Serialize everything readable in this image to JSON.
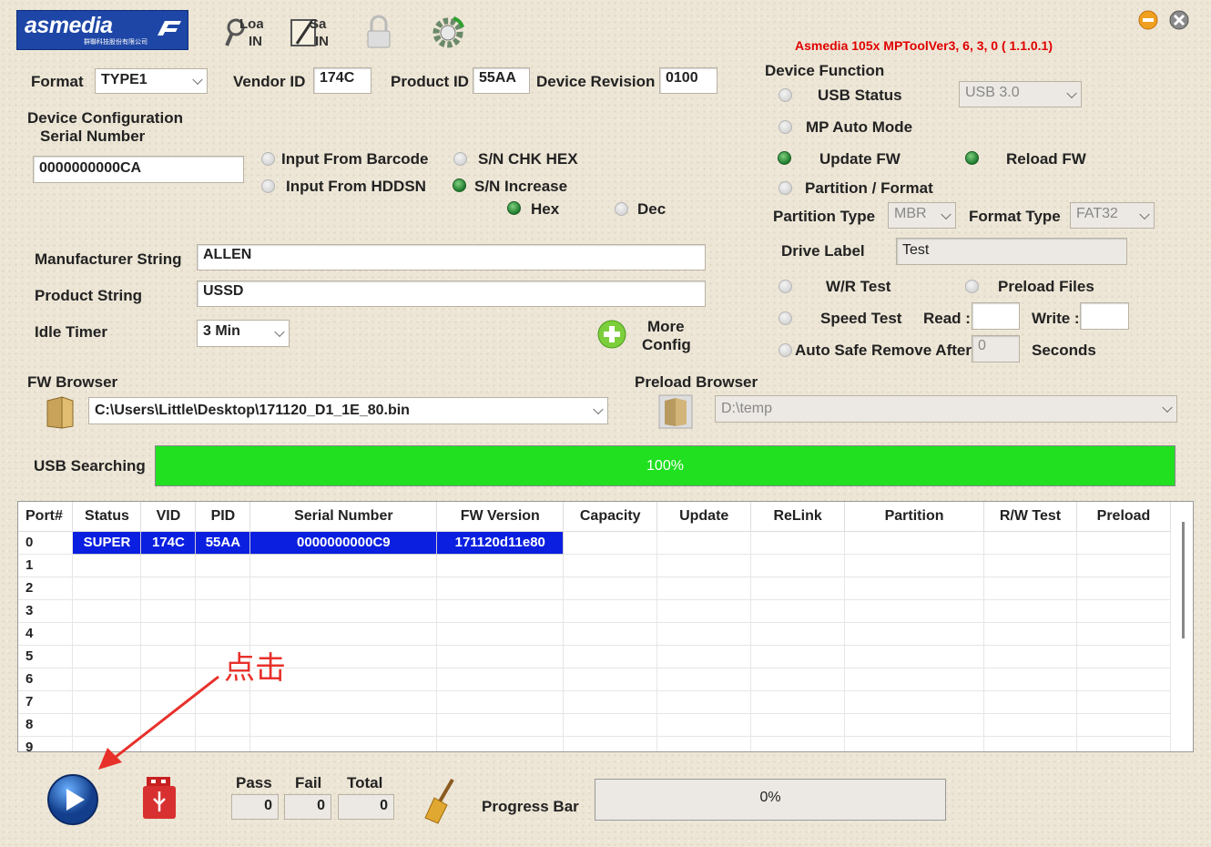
{
  "window": {
    "logo_text": "asmedia",
    "logo_sub": "群聯科技股份有限公司",
    "title": "Asmedia 105x MPToolVer3, 6, 3, 0 ( 1.1.0.1)"
  },
  "toolbar": {
    "load_label": "Load INI",
    "save_label": "Save INI",
    "lock_label": "Lock",
    "settings_label": "Settings"
  },
  "format": {
    "label": "Format",
    "value": "TYPE1"
  },
  "vendor_id": {
    "label": "Vendor ID",
    "value": "174C"
  },
  "product_id": {
    "label": "Product ID",
    "value": "55AA"
  },
  "device_revision": {
    "label": "Device Revision",
    "value": "0100"
  },
  "device_config": {
    "label1": "Device Configuration",
    "label2": "Serial Number",
    "serial": "0000000000CA",
    "input_barcode": "Input From Barcode",
    "input_hdd": "Input From HDDSN",
    "sn_chk_hex": "S/N CHK HEX",
    "sn_increase": "S/N Increase",
    "hex": "Hex",
    "dec": "Dec"
  },
  "manufacturer": {
    "label": "Manufacturer String",
    "value": "ALLEN"
  },
  "product_string": {
    "label": "Product String",
    "value": "USSD"
  },
  "idle_timer": {
    "label": "Idle Timer",
    "value": "3 Min"
  },
  "more_config": {
    "line1": "More",
    "line2": "Config"
  },
  "device_function": {
    "label": "Device Function",
    "usb_status": "USB Status",
    "usb_value": "USB 3.0",
    "mp_auto": "MP Auto Mode",
    "update_fw": "Update FW",
    "reload_fw": "Reload FW",
    "partition_format": "Partition / Format",
    "partition_type_label": "Partition Type",
    "partition_type": "MBR",
    "format_type_label": "Format Type",
    "format_type": "FAT32",
    "drive_label": "Drive Label",
    "drive_value": "Test",
    "wr_test": "W/R Test",
    "preload_files": "Preload Files",
    "speed_test": "Speed Test",
    "read": "Read :",
    "write": "Write :",
    "auto_safe": "Auto Safe Remove After",
    "auto_safe_value": "0",
    "seconds": "Seconds"
  },
  "fw_browser": {
    "label": "FW Browser",
    "path": "C:\\Users\\Little\\Desktop\\171120_D1_1E_80.bin"
  },
  "preload_browser": {
    "label": "Preload Browser",
    "path": "D:\\temp"
  },
  "usb_search": {
    "label": "USB Searching",
    "progress_text": "100%",
    "progress": 1.0
  },
  "table": {
    "headers": [
      "Port#",
      "Status",
      "VID",
      "PID",
      "Serial Number",
      "FW Version",
      "Capacity",
      "Update",
      "ReLink",
      "Partition",
      "R/W Test",
      "Preload"
    ],
    "rows": [
      [
        "0",
        "SUPER",
        "174C",
        "55AA",
        "0000000000C9",
        "171120d11e80",
        "",
        "",
        "",
        "",
        "",
        ""
      ],
      [
        "1",
        "",
        "",
        "",
        "",
        "",
        "",
        "",
        "",
        "",
        "",
        ""
      ],
      [
        "2",
        "",
        "",
        "",
        "",
        "",
        "",
        "",
        "",
        "",
        "",
        ""
      ],
      [
        "3",
        "",
        "",
        "",
        "",
        "",
        "",
        "",
        "",
        "",
        "",
        ""
      ],
      [
        "4",
        "",
        "",
        "",
        "",
        "",
        "",
        "",
        "",
        "",
        "",
        ""
      ],
      [
        "5",
        "",
        "",
        "",
        "",
        "",
        "",
        "",
        "",
        "",
        "",
        ""
      ],
      [
        "6",
        "",
        "",
        "",
        "",
        "",
        "",
        "",
        "",
        "",
        "",
        ""
      ],
      [
        "7",
        "",
        "",
        "",
        "",
        "",
        "",
        "",
        "",
        "",
        "",
        ""
      ],
      [
        "8",
        "",
        "",
        "",
        "",
        "",
        "",
        "",
        "",
        "",
        "",
        ""
      ],
      [
        "9",
        "",
        "",
        "",
        "",
        "",
        "",
        "",
        "",
        "",
        "",
        ""
      ]
    ]
  },
  "annotation": {
    "text": "点击"
  },
  "stats": {
    "pass_label": "Pass",
    "fail_label": "Fail",
    "total_label": "Total",
    "pass": "0",
    "fail": "0",
    "total": "0"
  },
  "progress": {
    "label": "Progress Bar",
    "text": "0%",
    "value": 0
  },
  "colors": {
    "accent_red": "#e00000",
    "progress_green": "#20e020",
    "selection_blue": "#0a1fe0",
    "logo_blue": "#1e46a6"
  }
}
